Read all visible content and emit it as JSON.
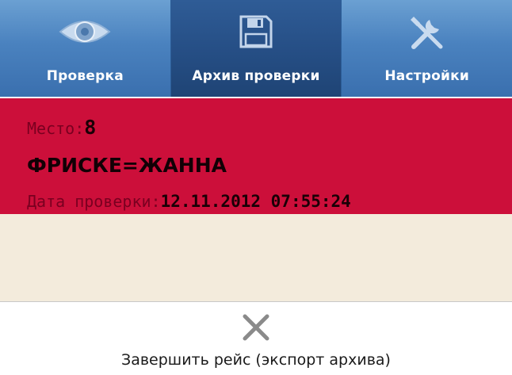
{
  "tabs": [
    {
      "label": "Проверка",
      "icon": "eye-icon",
      "active": false
    },
    {
      "label": "Архив проверки",
      "icon": "floppy-disk-icon",
      "active": true
    },
    {
      "label": "Настройки",
      "icon": "tools-icon",
      "active": false
    }
  ],
  "record": {
    "seat_label": "Место:",
    "seat_value": "8",
    "name": "ФРИСКЕ=ЖАННА",
    "date_label": "Дата проверки:",
    "date_value": "12.11.2012 07:55:24"
  },
  "footer": {
    "finish_label": "Завершить рейс (экспорт архива)",
    "finish_icon": "close-icon"
  },
  "colors": {
    "tab_bg": "#4a82bf",
    "tab_active_bg": "#264f86",
    "record_bg": "#cc0f3a",
    "empty_area_bg": "#f3ebdc"
  }
}
